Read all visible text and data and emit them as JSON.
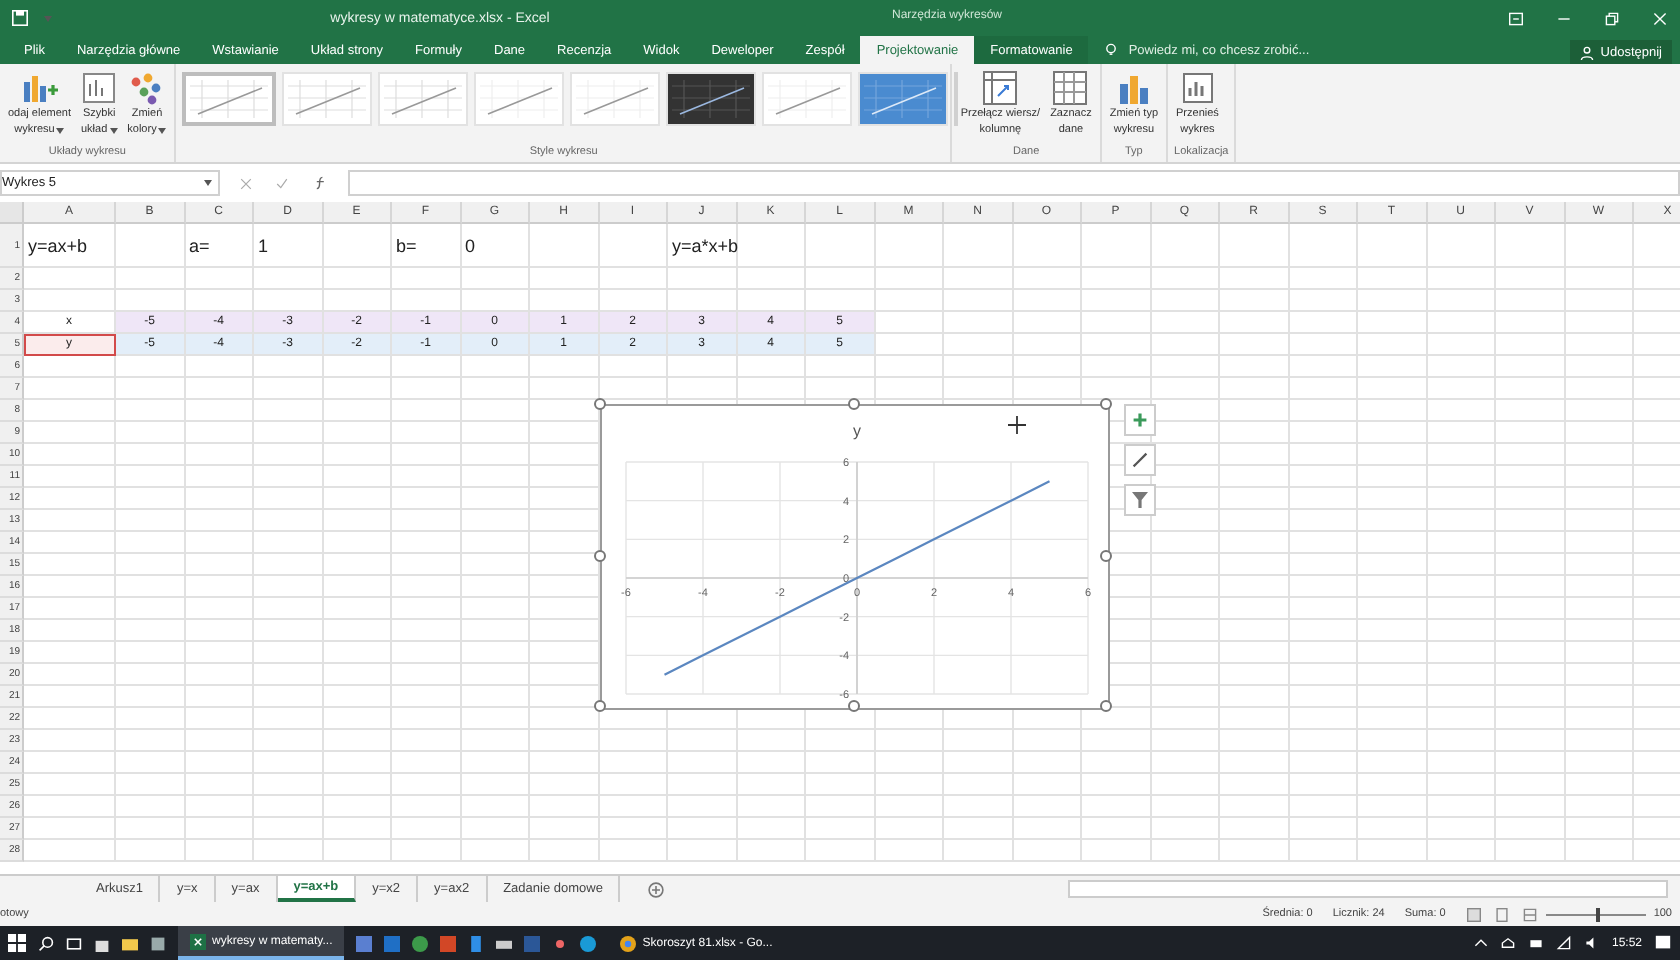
{
  "window": {
    "title": "wykresy w matematyce.xlsx - Excel",
    "context_title": "Narzędzia wykresów"
  },
  "ribbon_tabs": [
    {
      "label": "Plik",
      "selected": false,
      "kind": "normal"
    },
    {
      "label": "Narzędzia główne",
      "selected": false,
      "kind": "normal"
    },
    {
      "label": "Wstawianie",
      "selected": false,
      "kind": "normal"
    },
    {
      "label": "Układ strony",
      "selected": false,
      "kind": "normal"
    },
    {
      "label": "Formuły",
      "selected": false,
      "kind": "normal"
    },
    {
      "label": "Dane",
      "selected": false,
      "kind": "normal"
    },
    {
      "label": "Recenzja",
      "selected": false,
      "kind": "normal"
    },
    {
      "label": "Widok",
      "selected": false,
      "kind": "normal"
    },
    {
      "label": "Deweloper",
      "selected": false,
      "kind": "normal"
    },
    {
      "label": "Zespół",
      "selected": false,
      "kind": "normal"
    },
    {
      "label": "Projektowanie",
      "selected": true,
      "kind": "context"
    },
    {
      "label": "Formatowanie",
      "selected": false,
      "kind": "context"
    }
  ],
  "tell_me": {
    "placeholder": "Powiedz mi, co chcesz zrobić..."
  },
  "share_button": "Udostępnij",
  "ribbon_groups": [
    {
      "label": "Układy wykresu",
      "kind": "buttons",
      "buttons": [
        {
          "lines": [
            "odaj element",
            "wykresu"
          ],
          "dropdown": true
        },
        {
          "lines": [
            "Szybki",
            "układ"
          ],
          "dropdown": true
        },
        {
          "lines": [
            "Zmień",
            "kolory"
          ],
          "dropdown": true
        }
      ]
    },
    {
      "label": "Style wykresu",
      "kind": "gallery",
      "styles": [
        {
          "kind": "light",
          "selected": true
        },
        {
          "kind": "light",
          "selected": false
        },
        {
          "kind": "light",
          "selected": false
        },
        {
          "kind": "faint",
          "selected": false
        },
        {
          "kind": "faint",
          "selected": false
        },
        {
          "kind": "dark",
          "selected": false
        },
        {
          "kind": "faint",
          "selected": false
        },
        {
          "kind": "blue",
          "selected": false
        }
      ]
    },
    {
      "label": "Dane",
      "kind": "buttons",
      "buttons": [
        {
          "lines": [
            "Przełącz wiersz/",
            "kolumnę"
          ],
          "dropdown": false
        },
        {
          "lines": [
            "Zaznacz",
            "dane"
          ],
          "dropdown": false
        }
      ]
    },
    {
      "label": "Typ",
      "kind": "buttons",
      "buttons": [
        {
          "lines": [
            "Zmień typ",
            "wykresu"
          ],
          "dropdown": false
        }
      ]
    },
    {
      "label": "Lokalizacja",
      "kind": "buttons",
      "buttons": [
        {
          "lines": [
            "Przenieś",
            "wykres"
          ],
          "dropdown": false
        }
      ]
    }
  ],
  "name_box": "Wykres 5",
  "columns": [
    "A",
    "B",
    "C",
    "D",
    "E",
    "F",
    "G",
    "H",
    "I",
    "J",
    "K",
    "L",
    "M",
    "N",
    "O",
    "P",
    "Q",
    "R",
    "S",
    "T",
    "U",
    "V",
    "W",
    "X"
  ],
  "rows": [
    {
      "number": "1",
      "tall": true,
      "cells": [
        "y=ax+b",
        null,
        "a=",
        "1",
        null,
        "b=",
        "0",
        null,
        null,
        "y=a*x+b"
      ]
    },
    {
      "number": "2"
    },
    {
      "number": "3"
    },
    {
      "number": "4",
      "color": "#efe6f7",
      "cells": [
        "x",
        "-5",
        "-4",
        "-3",
        "-2",
        "-1",
        "0",
        "1",
        "2",
        "3",
        "4",
        "5"
      ]
    },
    {
      "number": "5",
      "color": "#e3eef9",
      "cells": [
        "y",
        "-5",
        "-4",
        "-3",
        "-2",
        "-1",
        "0",
        "1",
        "2",
        "3",
        "4",
        "5"
      ]
    },
    {
      "number": "6"
    },
    {
      "number": "7"
    },
    {
      "number": "8"
    },
    {
      "number": "9"
    },
    {
      "number": "10"
    },
    {
      "number": "11"
    },
    {
      "number": "12"
    },
    {
      "number": "13"
    },
    {
      "number": "14"
    },
    {
      "number": "15"
    },
    {
      "number": "16"
    },
    {
      "number": "17"
    },
    {
      "number": "18"
    },
    {
      "number": "19"
    },
    {
      "number": "20"
    },
    {
      "number": "21"
    },
    {
      "number": "22"
    },
    {
      "number": "23"
    },
    {
      "number": "24"
    },
    {
      "number": "25"
    },
    {
      "number": "26"
    },
    {
      "number": "27"
    },
    {
      "number": "28"
    }
  ],
  "chart": {
    "chart_data": {
      "type": "line",
      "grid": true,
      "x": [
        -5,
        -4,
        -3,
        -2,
        -1,
        0,
        1,
        2,
        3,
        4,
        5
      ],
      "series": [
        {
          "name": "y",
          "color": "#5b87c0",
          "values": [
            -5,
            -4,
            -3,
            -2,
            -1,
            0,
            1,
            2,
            3,
            4,
            5
          ]
        }
      ],
      "xlim": [
        -6,
        6
      ],
      "ylim": [
        -6,
        6
      ],
      "xticks": [
        -6,
        -4,
        -2,
        0,
        2,
        4,
        6
      ],
      "yticks": [
        -6,
        -4,
        -2,
        0,
        2,
        4,
        6
      ]
    }
  },
  "sheet_tabs": [
    {
      "label": "Arkusz1",
      "selected": false
    },
    {
      "label": "y=x",
      "selected": false
    },
    {
      "label": "y=ax",
      "selected": false
    },
    {
      "label": "y=ax+b",
      "selected": true
    },
    {
      "label": "y=x2",
      "selected": false
    },
    {
      "label": "y=ax2",
      "selected": false
    },
    {
      "label": "Zadanie domowe",
      "selected": false
    }
  ],
  "status": {
    "mode": "otowy",
    "stats": [
      "Średnia: 0",
      "Licznik: 24",
      "Suma: 0"
    ],
    "zoom": {
      "level": 0.5,
      "reading": "100"
    }
  },
  "taskbar": {
    "apps": [
      {
        "label": "wykresy w matematy...",
        "kind": "excel",
        "active": true
      },
      {
        "label": "Skoroszyt 81.xlsx - Go...",
        "kind": "chrome",
        "active": false
      }
    ],
    "time": "15:52"
  }
}
